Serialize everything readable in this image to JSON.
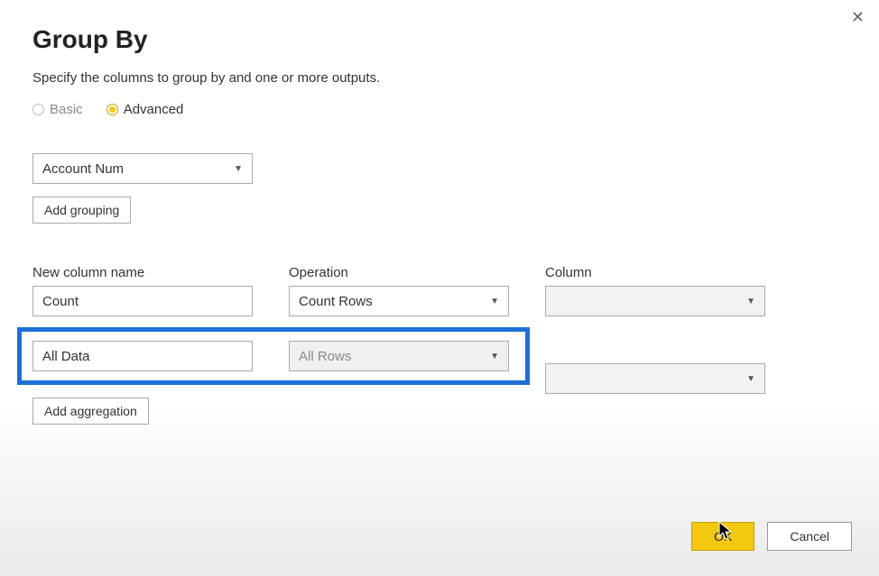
{
  "dialog": {
    "title": "Group By",
    "subtitle": "Specify the columns to group by and one or more outputs.",
    "close_glyph": "✕"
  },
  "mode": {
    "basic_label": "Basic",
    "advanced_label": "Advanced",
    "selected": "Advanced"
  },
  "grouping": {
    "column_value": "Account Num",
    "add_grouping_label": "Add grouping"
  },
  "headers": {
    "name": "New column name",
    "operation": "Operation",
    "column": "Column"
  },
  "aggregations": [
    {
      "name": "Count",
      "operation": "Count Rows",
      "column": ""
    },
    {
      "name": "All Data",
      "operation": "All Rows",
      "column": ""
    }
  ],
  "add_aggregation_label": "Add aggregation",
  "buttons": {
    "ok": "OK",
    "cancel": "Cancel"
  }
}
